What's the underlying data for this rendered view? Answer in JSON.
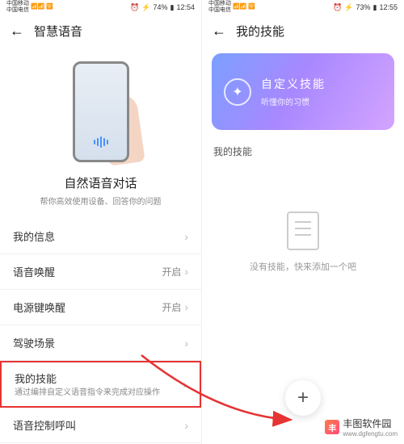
{
  "left": {
    "status": {
      "carrier1": "中国移动",
      "carrier2": "中国电信",
      "battery": "74%",
      "time": "12:54"
    },
    "header": {
      "title": "智慧语音"
    },
    "hero": {
      "title": "自然语音对话",
      "subtitle": "帮你高效使用设备、回答你的问题"
    },
    "items": [
      {
        "label": "我的信息",
        "value": ""
      },
      {
        "label": "语音唤醒",
        "value": "开启"
      },
      {
        "label": "电源键唤醒",
        "value": "开启"
      },
      {
        "label": "驾驶场景",
        "value": ""
      },
      {
        "label": "我的技能",
        "sublabel": "通过编排自定义语音指令来完成对应操作",
        "value": ""
      },
      {
        "label": "语音控制呼叫",
        "value": ""
      }
    ]
  },
  "right": {
    "status": {
      "carrier1": "中国移动",
      "carrier2": "中国电信",
      "battery": "73%",
      "time": "12:55"
    },
    "header": {
      "title": "我的技能"
    },
    "card": {
      "title": "自定义技能",
      "subtitle": "听懂你的习惯"
    },
    "section_title": "我的技能",
    "empty": {
      "text": "没有技能，快来添加一个吧"
    }
  },
  "watermark": {
    "text": "丰图软件园",
    "url": "www.dgfengtu.com"
  }
}
